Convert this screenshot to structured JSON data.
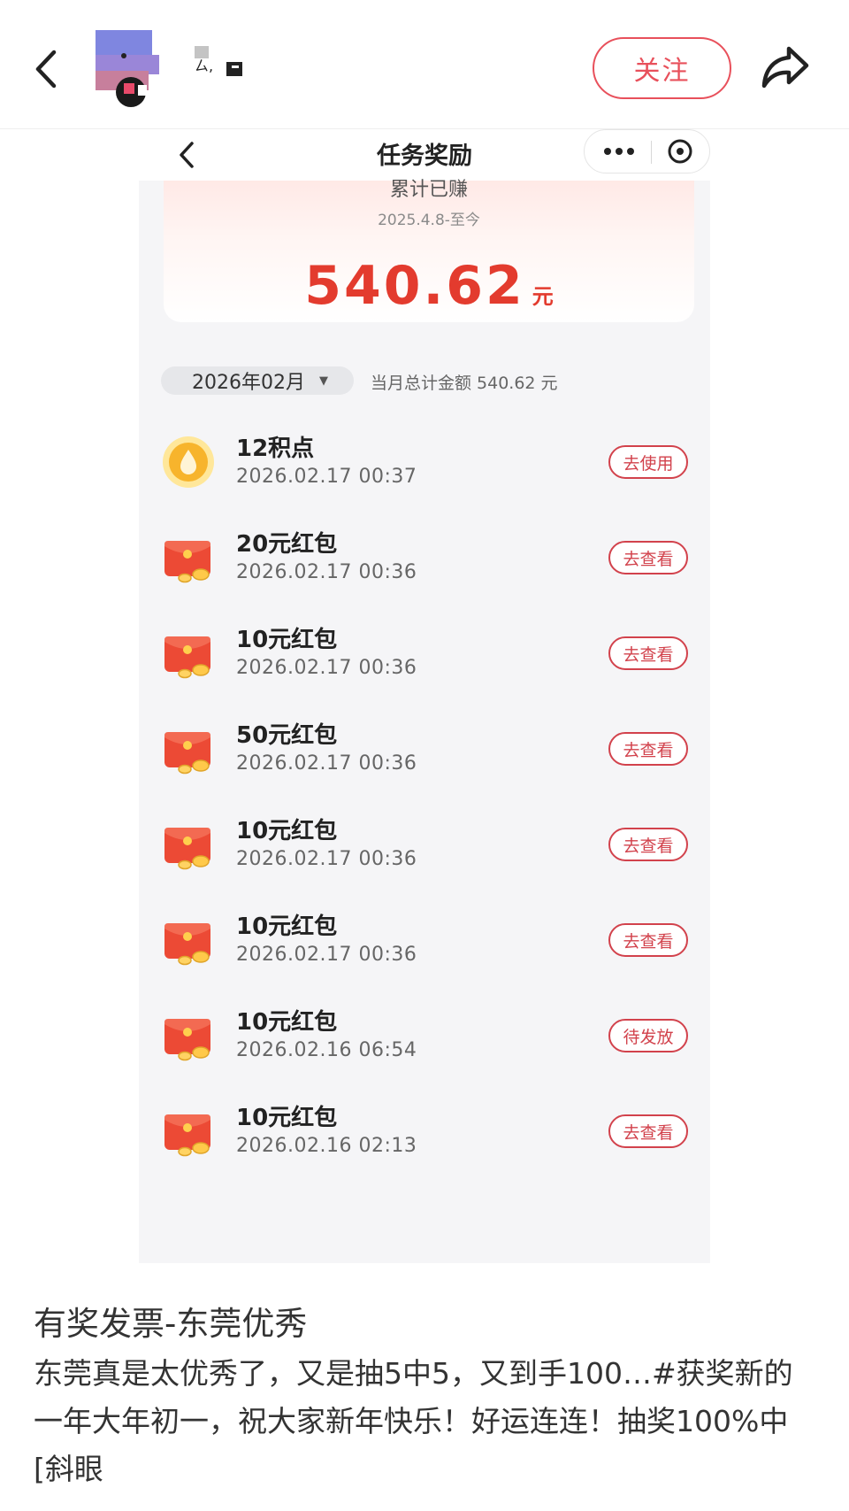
{
  "header": {
    "back_icon": "chevron-left-icon",
    "avatar_icon": "avatar",
    "user_name": "",
    "follow_label": "关注",
    "share_icon": "share-arrow-icon",
    "accent_color": "#e8505b"
  },
  "screenshot": {
    "nav": {
      "title": "任务奖励",
      "back_icon": "chevron-left-icon",
      "more_icon": "more-dots-icon",
      "close_icon": "close-circle-icon"
    },
    "summary": {
      "label": "累计已赚",
      "period": "2025.4.8-至今",
      "amount": "540.62",
      "unit": "元",
      "amount_color": "#e33b2e"
    },
    "filter": {
      "month": "2026年02月",
      "caret": "▼",
      "month_total": "当月总计金额 540.62 元"
    },
    "records": [
      {
        "icon": "points-coin-icon",
        "title": "12积点",
        "time": "2026.02.17 00:37",
        "action": "去使用"
      },
      {
        "icon": "red-envelope-icon",
        "title": "20元红包",
        "time": "2026.02.17 00:36",
        "action": "去查看"
      },
      {
        "icon": "red-envelope-icon",
        "title": "10元红包",
        "time": "2026.02.17 00:36",
        "action": "去查看"
      },
      {
        "icon": "red-envelope-icon",
        "title": "50元红包",
        "time": "2026.02.17 00:36",
        "action": "去查看"
      },
      {
        "icon": "red-envelope-icon",
        "title": "10元红包",
        "time": "2026.02.17 00:36",
        "action": "去查看"
      },
      {
        "icon": "red-envelope-icon",
        "title": "10元红包",
        "time": "2026.02.17 00:36",
        "action": "去查看"
      },
      {
        "icon": "red-envelope-icon",
        "title": "10元红包",
        "time": "2026.02.16 06:54",
        "action": "待发放"
      },
      {
        "icon": "red-envelope-icon",
        "title": "10元红包",
        "time": "2026.02.16 02:13",
        "action": "去查看"
      }
    ]
  },
  "post": {
    "title": "有奖发票-东莞优秀",
    "body": "东莞真是太优秀了，又是抽5中5，又到手100…#获奖新的一年大年初一，祝大家新年快乐！好运连连！抽奖100%中[斜眼"
  }
}
